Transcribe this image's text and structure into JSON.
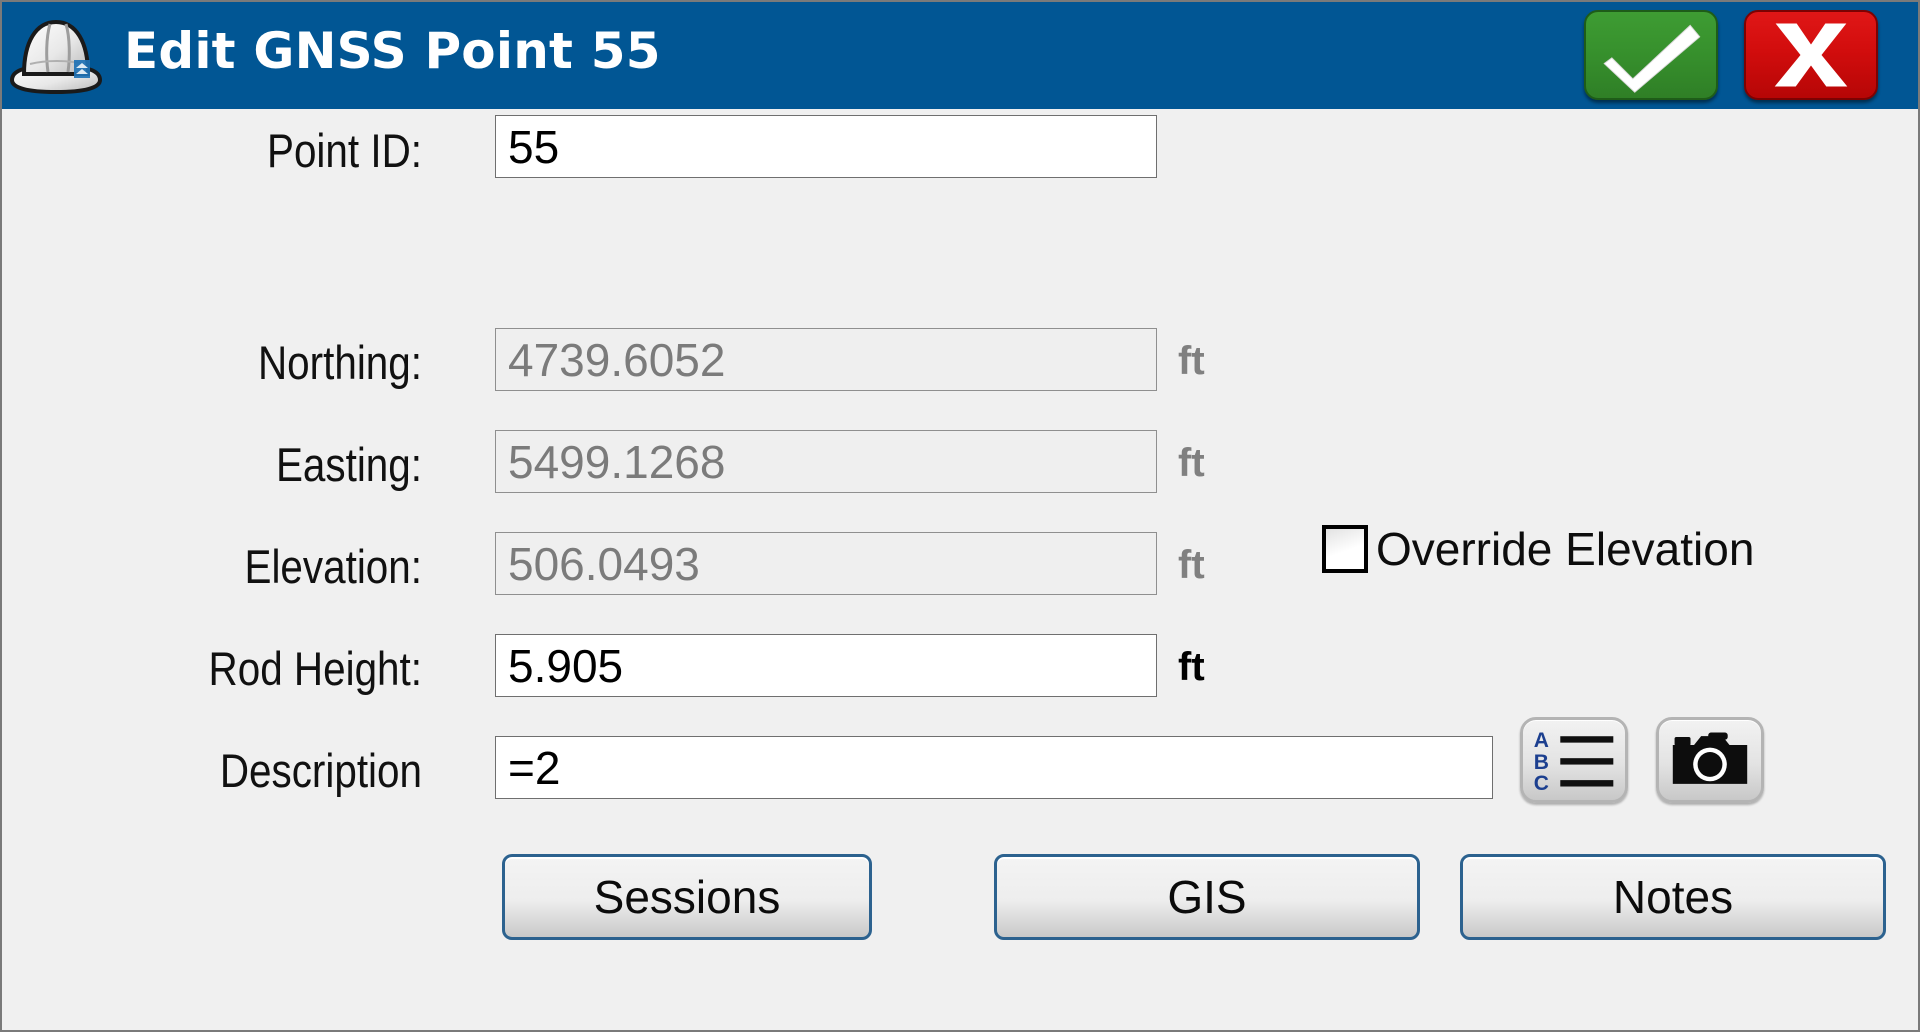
{
  "window": {
    "title": "Edit GNSS Point 55",
    "app_icon": "hard-hat-icon",
    "accept_icon": "check-icon",
    "cancel_icon": "x-icon",
    "titlebar_color": "#015694",
    "accept_color": "#37912d",
    "cancel_color": "#d20d0d"
  },
  "fields": {
    "point_id": {
      "label": "Point ID:",
      "value": "55",
      "enabled": true,
      "unit": ""
    },
    "northing": {
      "label": "Northing:",
      "value": "4739.6052",
      "enabled": false,
      "unit": "ft"
    },
    "easting": {
      "label": "Easting:",
      "value": "5499.1268",
      "enabled": false,
      "unit": "ft"
    },
    "elevation": {
      "label": "Elevation:",
      "value": "506.0493",
      "enabled": false,
      "unit": "ft"
    },
    "rod_height": {
      "label": "Rod Height:",
      "value": "5.905",
      "enabled": true,
      "unit": "ft"
    },
    "description": {
      "label": "Description",
      "value": "=2",
      "enabled": true,
      "unit": ""
    }
  },
  "override_elevation": {
    "label": "Override Elevation",
    "checked": false
  },
  "icon_buttons": {
    "description_list": {
      "icon": "abc-list-icon",
      "letters": [
        "A",
        "B",
        "C"
      ],
      "letter_color": "#1c3f8f"
    },
    "camera": {
      "icon": "camera-icon"
    }
  },
  "bottom_buttons": [
    {
      "label": "Sessions"
    },
    {
      "label": "GIS"
    },
    {
      "label": "Notes"
    }
  ]
}
